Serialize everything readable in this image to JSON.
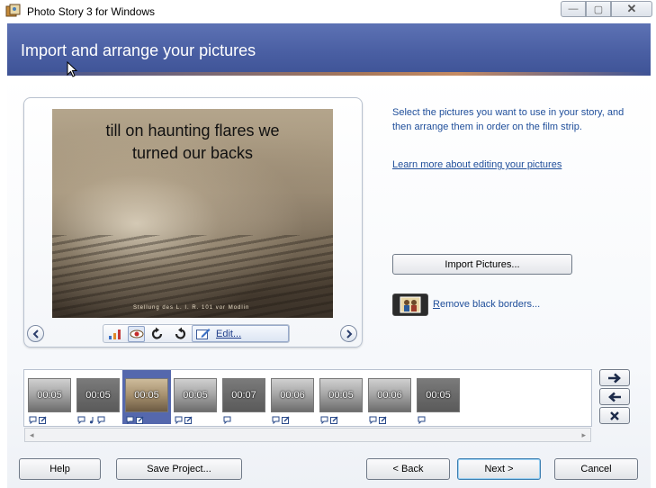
{
  "window": {
    "title": "Photo Story 3 for Windows",
    "min_glyph": "—",
    "max_glyph": "▢",
    "close_glyph": "✕"
  },
  "header": {
    "title": "Import and arrange your pictures"
  },
  "preview": {
    "caption_line1": "till on haunting flares we",
    "caption_line2": "turned our backs",
    "footnote": "Stellung des L. I. R. 101 vor Modlin",
    "edit_label": "Edit..."
  },
  "right_panel": {
    "instructions": "Select the pictures you want to use in your story, and then arrange them in order on the film strip.",
    "learn_link": "Learn more about editing your pictures",
    "import_button": "Import Pictures...",
    "remove_borders_prefix": "R",
    "remove_borders_rest": "emove black borders..."
  },
  "filmstrip": {
    "items": [
      {
        "time": "00:05"
      },
      {
        "time": "00:05"
      },
      {
        "time": "00:05"
      },
      {
        "time": "00:05"
      },
      {
        "time": "00:07"
      },
      {
        "time": "00:06"
      },
      {
        "time": "00:05"
      },
      {
        "time": "00:06"
      },
      {
        "time": "00:05"
      }
    ],
    "selected_index": 2
  },
  "buttons": {
    "help": "Help",
    "save_project": "Save Project...",
    "back": "< Back",
    "next": "Next >",
    "cancel": "Cancel"
  },
  "colors": {
    "header": "#4a5fa3",
    "link": "#1f4e9a",
    "selected_thumb": "#5568ad"
  }
}
